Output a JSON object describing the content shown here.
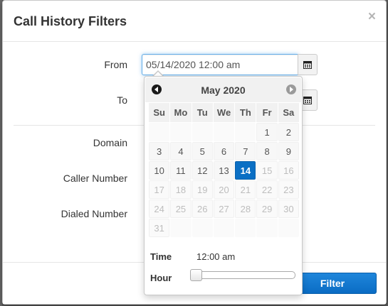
{
  "modal": {
    "title": "Call History Filters",
    "close_symbol": "×"
  },
  "form": {
    "from_label": "From",
    "from_value": "05/14/2020 12:00 am",
    "to_label": "To",
    "domain_label": "Domain",
    "caller_label": "Caller Number",
    "dialed_label": "Dialed Number"
  },
  "picker": {
    "month": "May 2020",
    "weekdays": [
      "Su",
      "Mo",
      "Tu",
      "We",
      "Th",
      "Fr",
      "Sa"
    ],
    "weeks": [
      [
        "",
        "",
        "",
        "",
        "",
        "1",
        "2"
      ],
      [
        "3",
        "4",
        "5",
        "6",
        "7",
        "8",
        "9"
      ],
      [
        "10",
        "11",
        "12",
        "13",
        "14",
        "15",
        "16"
      ],
      [
        "17",
        "18",
        "19",
        "20",
        "21",
        "22",
        "23"
      ],
      [
        "24",
        "25",
        "26",
        "27",
        "28",
        "29",
        "30"
      ],
      [
        "31",
        "",
        "",
        "",
        "",
        "",
        ""
      ]
    ],
    "selected_day": "14",
    "time_label": "Time",
    "time_value": "12:00 am",
    "hour_label": "Hour",
    "hour_slider_value": 0
  },
  "footer": {
    "filter_label": "Filter"
  },
  "colors": {
    "accent": "#0a6fc4",
    "focus_border": "#66afe9"
  },
  "icons": [
    "close-icon",
    "calendar-icon",
    "chevron-left-icon",
    "chevron-right-icon"
  ]
}
